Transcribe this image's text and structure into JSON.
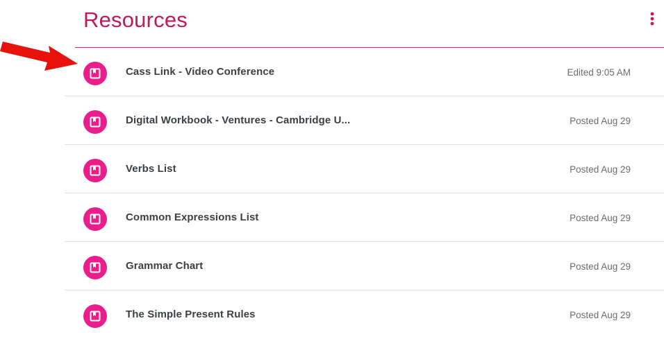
{
  "header": {
    "title": "Resources",
    "more_icon": "more-vert-icon"
  },
  "colors": {
    "accent": "#e91e8c",
    "title": "#c2185b",
    "arrow": "#e8120c"
  },
  "resources": [
    {
      "title": "Cass Link - Video Conference",
      "meta": "Edited 9:05 AM",
      "icon": "material-book-icon"
    },
    {
      "title": "Digital Workbook - Ventures - Cambridge U...",
      "meta": "Posted Aug 29",
      "icon": "material-book-icon"
    },
    {
      "title": "Verbs List",
      "meta": "Posted Aug 29",
      "icon": "material-book-icon"
    },
    {
      "title": "Common Expressions List",
      "meta": "Posted Aug 29",
      "icon": "material-book-icon"
    },
    {
      "title": "Grammar Chart",
      "meta": "Posted Aug 29",
      "icon": "material-book-icon"
    },
    {
      "title": "The Simple Present Rules",
      "meta": "Posted Aug 29",
      "icon": "material-book-icon"
    }
  ]
}
